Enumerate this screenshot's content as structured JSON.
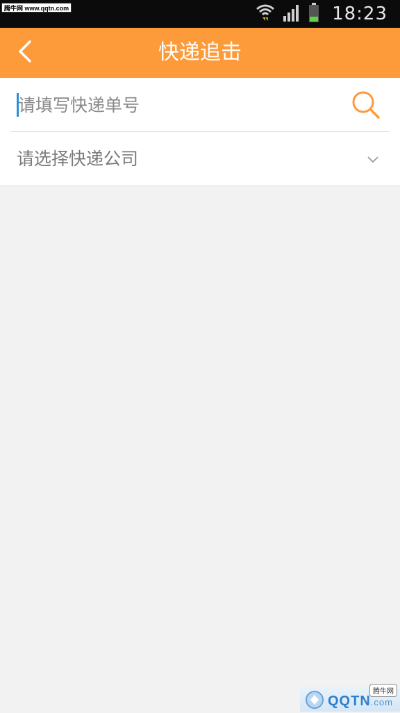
{
  "status_bar": {
    "watermark": "腾牛网 www.qqtn.com",
    "time": "18:23",
    "icons": [
      "wifi-icon",
      "signal-icon",
      "battery-icon"
    ]
  },
  "app_bar": {
    "back_icon": "chevron-left-icon",
    "title": "快递追击"
  },
  "tracking_form": {
    "number_placeholder": "请填写快递单号",
    "number_value": "",
    "search_icon": "search-icon",
    "company_placeholder": "请选择快递公司",
    "dropdown_icon": "chevron-down-icon"
  },
  "watermark_bottom": {
    "logo_text": "QQTN",
    "domain": ".com",
    "badge": "腾牛网"
  },
  "colors": {
    "accent": "#fd9a3a",
    "background": "#f2f2f2",
    "caret": "#2a8fd8"
  }
}
